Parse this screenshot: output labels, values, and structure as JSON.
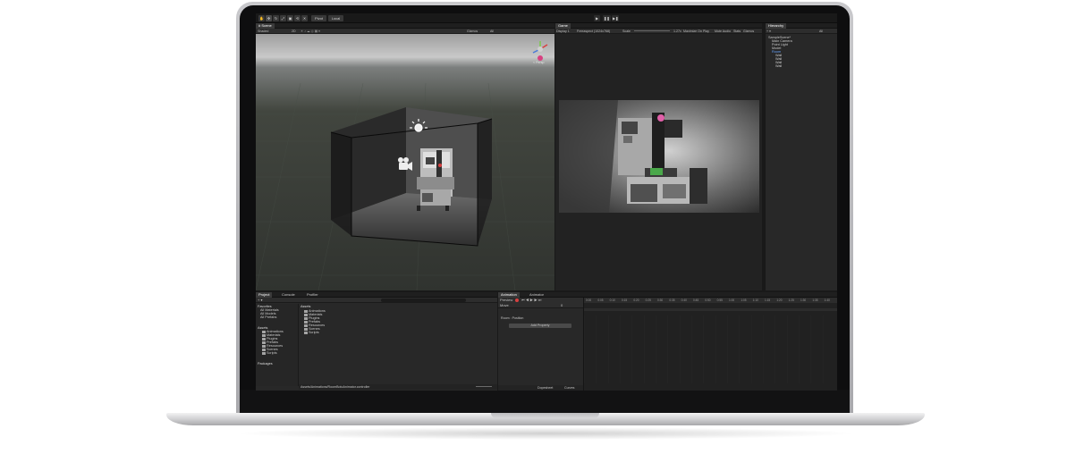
{
  "toolbar": {
    "tools": [
      "✋",
      "✥",
      "↻",
      "⤢",
      "▣",
      "⟲",
      "✕"
    ],
    "pivot_label": "Pivot",
    "local_label": "Local",
    "play_icons": [
      "▶",
      "❚❚",
      "▶❚"
    ]
  },
  "scene": {
    "tab_label": "# Scene",
    "shading_mode": "Shaded",
    "dim_mode": "2D",
    "gizmos_label": "Gizmos",
    "search_label": "All",
    "persp_label": "< Persp"
  },
  "game": {
    "tab_label": "Game",
    "display_label": "Display 1",
    "resolution_label": "Freeaspect (1024x768)",
    "scale_label": "Scale",
    "scale_value": "1.27x",
    "maximize_label": "Maximize On Play",
    "mute_label": "Mute Audio",
    "stats_label": "Stats",
    "gizmos_label": "Gizmos"
  },
  "hierarchy": {
    "tab_label": "Hierarchy",
    "add_label": "+ ▾",
    "search_label": "All",
    "items": [
      {
        "label": "SampleScene*",
        "indent": 0,
        "selected": false
      },
      {
        "label": "Main Camera",
        "indent": 1,
        "selected": false
      },
      {
        "label": "Point Light",
        "indent": 1,
        "selected": false
      },
      {
        "label": "Model",
        "indent": 1,
        "selected": false
      },
      {
        "label": "Room",
        "indent": 1,
        "selected": true
      },
      {
        "label": "Wall",
        "indent": 2,
        "selected": false
      },
      {
        "label": "Wall",
        "indent": 2,
        "selected": false
      },
      {
        "label": "Wall",
        "indent": 2,
        "selected": false
      },
      {
        "label": "Wall",
        "indent": 2,
        "selected": false
      }
    ]
  },
  "project": {
    "tabs": [
      "Project",
      "Console",
      "Profiler"
    ],
    "favorites_label": "Favorites",
    "favorites": [
      "All Materials",
      "All Models",
      "All Prefabs"
    ],
    "assets_label": "Assets",
    "asset_tree": [
      "Animations",
      "Materials",
      "Plugins",
      "Prefabs",
      "Resources",
      "Scenes",
      "Scripts"
    ],
    "packages_label": "Packages",
    "breadcrumb": "Assets",
    "files": [
      "Animations",
      "Materials",
      "Plugins",
      "Prefabs",
      "Resources",
      "Scenes",
      "Scripts"
    ],
    "path": "Assets/Animations/RoomBotoAnimator.controller",
    "slider_value": "0"
  },
  "animation": {
    "tabs": [
      "Animation",
      "Animator"
    ],
    "preview_label": "Preview",
    "clip_label": "Move",
    "frame_value": "0",
    "property_label": "Room : Position",
    "add_property_label": "Add Property",
    "dopesheet_label": "Dopesheet",
    "curves_label": "Curves",
    "ruler": [
      "0:00",
      "0:05",
      "0:10",
      "0:15",
      "0:20",
      "0:25",
      "0:30",
      "0:35",
      "0:40",
      "0:45",
      "0:50",
      "0:55",
      "1:00",
      "1:05",
      "1:10",
      "1:15",
      "1:20",
      "1:25",
      "1:30",
      "1:35",
      "1:40"
    ]
  },
  "colors": {
    "accent_blue": "#3a79d8",
    "record_red": "#d84040",
    "panel_bg": "#282828"
  }
}
